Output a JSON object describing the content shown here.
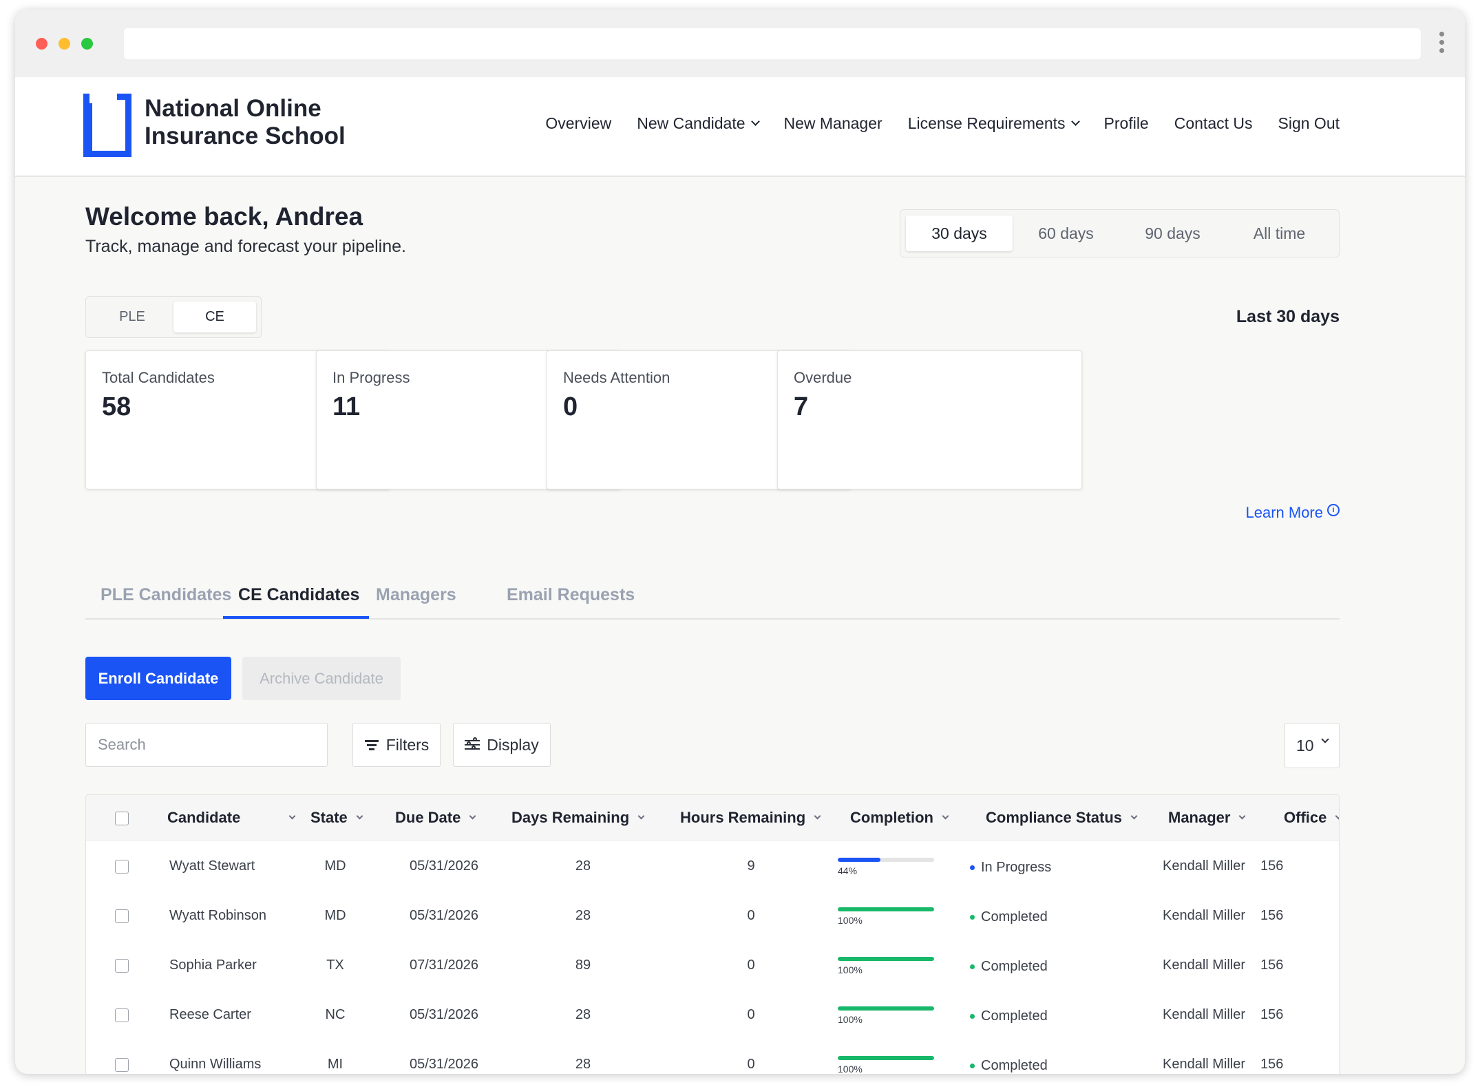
{
  "browser": {
    "url": ""
  },
  "brand": {
    "line1": "National Online",
    "line2": "Insurance School",
    "color": "#1a54f5"
  },
  "nav": [
    {
      "label": "Overview",
      "dropdown": false
    },
    {
      "label": "New Candidate",
      "dropdown": true
    },
    {
      "label": "New Manager",
      "dropdown": false
    },
    {
      "label": "License Requirements",
      "dropdown": true
    },
    {
      "label": "Profile",
      "dropdown": false
    },
    {
      "label": "Contact Us",
      "dropdown": false
    },
    {
      "label": "Sign Out",
      "dropdown": false
    }
  ],
  "welcome": {
    "title": "Welcome back, Andrea",
    "subtitle": "Track, manage and forecast your pipeline."
  },
  "range": {
    "options": [
      "30 days",
      "60 days",
      "90 days",
      "All time"
    ],
    "selected": "30 days"
  },
  "program": {
    "options": [
      "PLE",
      "CE"
    ],
    "selected": "CE"
  },
  "period_label": "Last 30 days",
  "stats": [
    {
      "label": "Total Candidates",
      "value": "58"
    },
    {
      "label": "In Progress",
      "value": "11"
    },
    {
      "label": "Needs Attention",
      "value": "0"
    },
    {
      "label": "Overdue",
      "value": "7"
    }
  ],
  "learn_more": "Learn More",
  "tabs": [
    {
      "label": "PLE Candidates",
      "active": false
    },
    {
      "label": "CE Candidates",
      "active": true
    },
    {
      "label": "Managers",
      "active": false
    },
    {
      "label": "Email Requests",
      "active": false
    }
  ],
  "actions": {
    "enroll": "Enroll Candidate",
    "archive": "Archive Candidate"
  },
  "toolbar": {
    "search_placeholder": "Search",
    "filters": "Filters",
    "display": "Display",
    "page_size": "10"
  },
  "table": {
    "columns": [
      "Candidate",
      "State",
      "Due Date",
      "Days Remaining",
      "Hours Remaining",
      "Completion",
      "Compliance Status",
      "Manager",
      "Office"
    ],
    "rows": [
      {
        "candidate": "Wyatt Stewart",
        "state": "MD",
        "due": "05/31/2026",
        "days": "28",
        "hours": "9",
        "completion": 44,
        "completion_label": "44%",
        "status": "In Progress",
        "manager": "Kendall Miller",
        "office": "156"
      },
      {
        "candidate": "Wyatt Robinson",
        "state": "MD",
        "due": "05/31/2026",
        "days": "28",
        "hours": "0",
        "completion": 100,
        "completion_label": "100%",
        "status": "Completed",
        "manager": "Kendall Miller",
        "office": "156"
      },
      {
        "candidate": "Sophia Parker",
        "state": "TX",
        "due": "07/31/2026",
        "days": "89",
        "hours": "0",
        "completion": 100,
        "completion_label": "100%",
        "status": "Completed",
        "manager": "Kendall Miller",
        "office": "156"
      },
      {
        "candidate": "Reese Carter",
        "state": "NC",
        "due": "05/31/2026",
        "days": "28",
        "hours": "0",
        "completion": 100,
        "completion_label": "100%",
        "status": "Completed",
        "manager": "Kendall Miller",
        "office": "156"
      },
      {
        "candidate": "Quinn Williams",
        "state": "MI",
        "due": "05/31/2026",
        "days": "28",
        "hours": "0",
        "completion": 100,
        "completion_label": "100%",
        "status": "Completed",
        "manager": "Kendall Miller",
        "office": "156"
      }
    ]
  },
  "colors": {
    "accent": "#1a54f5",
    "in_progress": "#1a54f5",
    "completed": "#18b86a"
  }
}
